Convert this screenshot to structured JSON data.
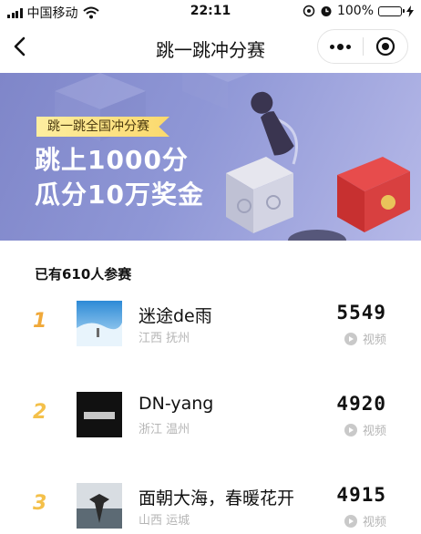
{
  "status_bar": {
    "carrier": "中国移动",
    "time": "22:11",
    "battery": "100%"
  },
  "nav": {
    "title": "跳一跳冲分赛"
  },
  "banner": {
    "tag": "跳一跳全国冲分赛",
    "line1": "跳上1000分",
    "line2": "瓜分10万奖金"
  },
  "ranking": {
    "count_text": "已有610人参赛",
    "items": [
      {
        "rank": "1",
        "rank_color": "#f0a93a",
        "name": "迷途de雨",
        "location": "江西 抚州",
        "score": "5549",
        "video_label": "视频"
      },
      {
        "rank": "2",
        "rank_color": "#f4c04a",
        "name": "DN-yang",
        "location": "浙江 温州",
        "score": "4920",
        "video_label": "视频"
      },
      {
        "rank": "3",
        "rank_color": "#f4c04a",
        "name": "面朝大海，春暖花开",
        "location": "山西 运城",
        "score": "4915",
        "video_label": "视频"
      }
    ]
  },
  "colors": {
    "banner_bg": "#8f97d6",
    "tag_bg": "#fbd96d",
    "battery": "#2ecc40"
  }
}
